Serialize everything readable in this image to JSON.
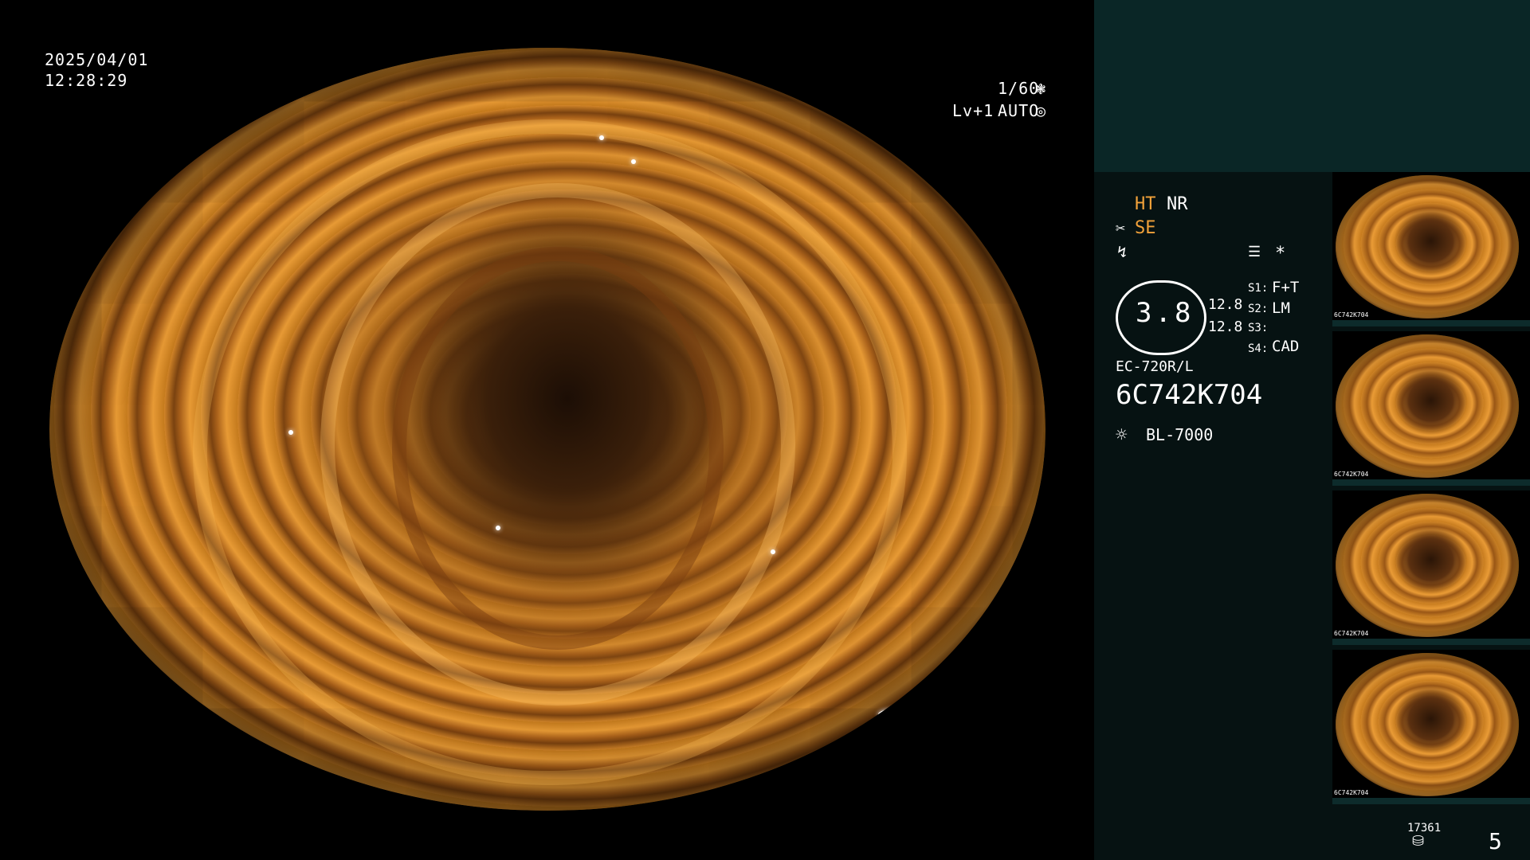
{
  "overlay": {
    "date": "2025/04/01",
    "time": "12:28:29",
    "shutter": "1/60",
    "level": "Lv+1",
    "mode": "AUTO"
  },
  "panel": {
    "ht": "HT",
    "nr": "NR",
    "se": "SE",
    "asterisk": "*",
    "gauge_value": "3.8",
    "gauge_right_1": "12.8",
    "gauge_right_2": "12.8",
    "s1_label": "S1:",
    "s1_value": "F+T",
    "s2_label": "S2:",
    "s2_value": "LM",
    "s3_label": "S3:",
    "s3_value": "",
    "s4_label": "S4:",
    "s4_value": "CAD",
    "scope_model": "EC-720R/L",
    "serial": "6C742K704",
    "light_source": "BL-7000",
    "storage_count": "17361",
    "page_number": "5"
  },
  "thumbnails": [
    {
      "label": "6C742K704"
    },
    {
      "label": "6C742K704"
    },
    {
      "label": "6C742K704"
    },
    {
      "label": "6C742K704"
    }
  ],
  "colors": {
    "panel_bg": "#061212",
    "panel_top_bg": "#0a2626",
    "accent_orange": "#f2a23a"
  },
  "icons": [
    "aperture-icon",
    "iris-icon",
    "scissors-icon",
    "lightning-icon",
    "settings-icon",
    "light-source-icon",
    "storage-icon"
  ]
}
